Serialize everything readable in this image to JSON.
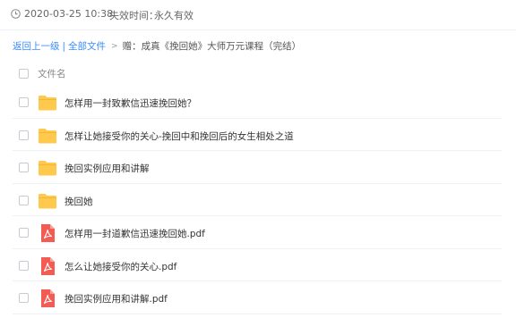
{
  "share_info": {
    "share_time": "2020-03-25 10:38",
    "expire_label": "失效时间：",
    "expire_value": "永久有效"
  },
  "breadcrumb": {
    "back_label": "返回上一级",
    "separator": "|",
    "all_files_label": "全部文件",
    "arrow": ">",
    "current_folder": "赠：成真《挽回她》大师万元课程（完结）"
  },
  "file_list": {
    "header_label": "文件名",
    "items": [
      {
        "name": "怎样用一封致歉信迅速挽回她？",
        "icon": "folder-icon"
      },
      {
        "name": "怎样让她接受你的关心-挽回中和挽回后的女生相处之道",
        "icon": "folder-icon"
      },
      {
        "name": "挽回实例应用和讲解",
        "icon": "folder-icon"
      },
      {
        "name": "挽回她",
        "icon": "folder-icon"
      },
      {
        "name": "怎样用一封道歉信迅速挽回她.pdf",
        "icon": "pdf-icon"
      },
      {
        "name": "怎么让她接受你的关心.pdf",
        "icon": "pdf-icon"
      },
      {
        "name": "挽回实例应用和讲解.pdf",
        "icon": "pdf-icon"
      }
    ]
  },
  "colors": {
    "link": "#3b8cff",
    "folder": "#ffc94d",
    "pdf": "#f25c54"
  }
}
